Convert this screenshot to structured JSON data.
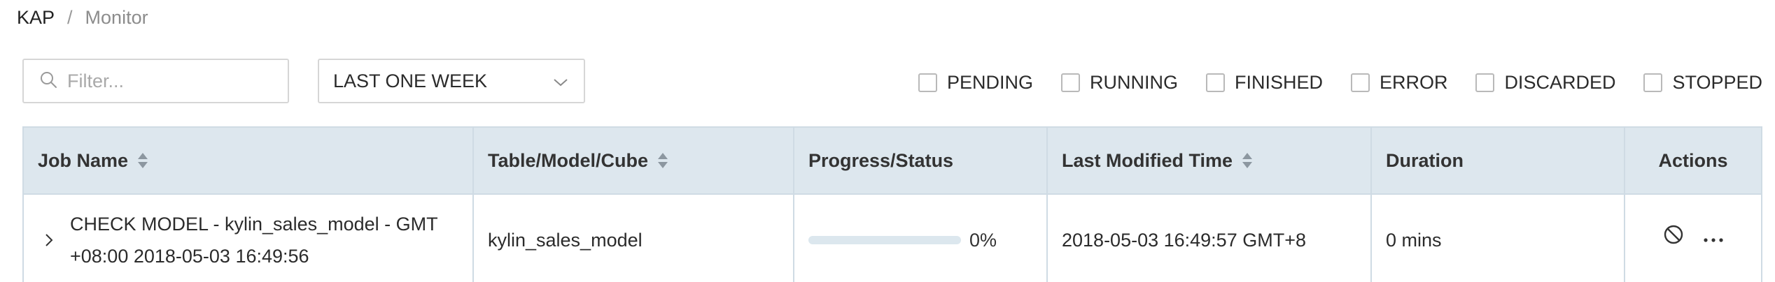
{
  "breadcrumb": {
    "root": "KAP",
    "separator": "/",
    "current": "Monitor"
  },
  "filter": {
    "placeholder": "Filter...",
    "value": ""
  },
  "time_range": {
    "selected": "LAST ONE WEEK"
  },
  "status_filters": [
    {
      "label": "PENDING",
      "checked": false
    },
    {
      "label": "RUNNING",
      "checked": false
    },
    {
      "label": "FINISHED",
      "checked": false
    },
    {
      "label": "ERROR",
      "checked": false
    },
    {
      "label": "DISCARDED",
      "checked": false
    },
    {
      "label": "STOPPED",
      "checked": false
    }
  ],
  "table": {
    "columns": [
      {
        "label": "Job Name",
        "sortable": true
      },
      {
        "label": "Table/Model/Cube",
        "sortable": true
      },
      {
        "label": "Progress/Status",
        "sortable": false
      },
      {
        "label": "Last Modified Time",
        "sortable": true
      },
      {
        "label": "Duration",
        "sortable": false
      },
      {
        "label": "Actions",
        "sortable": false
      }
    ],
    "rows": [
      {
        "job_name": "CHECK MODEL - kylin_sales_model - GMT +08:00 2018-05-03 16:49:56",
        "target": "kylin_sales_model",
        "progress": 0,
        "progress_label": "0%",
        "last_modified": "2018-05-03 16:49:57 GMT+8",
        "duration": "0 mins",
        "actions": [
          "ban-icon",
          "more-icon"
        ]
      }
    ]
  },
  "colors": {
    "header_bg": "#dde7ee",
    "border": "#cfdbe4",
    "progress_track": "#dce7ee",
    "progress_fill": "#3d9be9"
  }
}
